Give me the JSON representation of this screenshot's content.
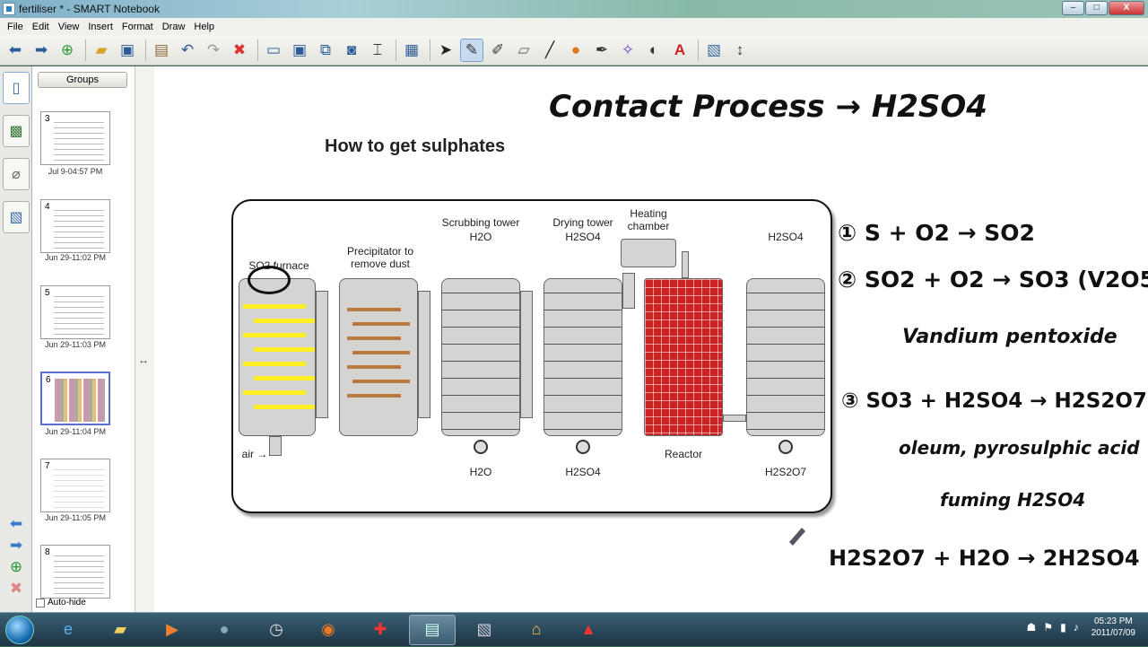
{
  "window": {
    "title": "fertiliser * - SMART Notebook",
    "min": "–",
    "max": "□",
    "close": "X"
  },
  "menu": [
    "File",
    "Edit",
    "View",
    "Insert",
    "Format",
    "Draw",
    "Help"
  ],
  "toolbar": {
    "icons": [
      "back-arrow-icon",
      "forward-arrow-icon",
      "add-page-icon",
      "open-folder-icon",
      "save-icon",
      "paste-icon",
      "undo-icon",
      "redo-icon",
      "delete-icon",
      "screen-shade-icon",
      "full-screen-icon",
      "dual-display-icon",
      "capture-icon",
      "table-icon",
      "insert-table-icon",
      "select-icon",
      "pen-icon",
      "creative-pen-icon",
      "eraser-icon",
      "line-icon",
      "shape-icon",
      "magic-pen-icon",
      "fill-icon",
      "text-icon",
      "properties-icon",
      "move-toolbar-icon"
    ]
  },
  "sorter": {
    "groups_label": "Groups",
    "autohide_label": "Auto-hide",
    "pages": [
      {
        "num": "3",
        "time": "Jul 9-04:57 PM"
      },
      {
        "num": "4",
        "time": "Jun 29-11:02 PM"
      },
      {
        "num": "5",
        "time": "Jun 29-11:03 PM"
      },
      {
        "num": "6",
        "time": "Jun 29-11:04 PM"
      },
      {
        "num": "7",
        "time": "Jun 29-11:05 PM"
      },
      {
        "num": "8",
        "time": ""
      }
    ]
  },
  "page": {
    "title": "How to get sulphates",
    "heading_ink": "Contact Process → H2SO4"
  },
  "diagram": {
    "labels": {
      "furnace": "SO2 furnace",
      "precipitator_1": "Precipitator to",
      "precipitator_2": "remove dust",
      "scrubbing": "Scrubbing tower",
      "scrubbing_in": "H2O",
      "drying": "Drying tower",
      "drying_in": "H2SO4",
      "heating_1": "Heating",
      "heating_2": "chamber",
      "absorber_in": "H2SO4",
      "air": "air →",
      "scrub_out": "H2O",
      "dry_out": "H2SO4",
      "reactor": "Reactor",
      "oleum_out": "H2S2O7"
    }
  },
  "notes": {
    "step1": "① S + O2 → SO2",
    "step2": "② SO2 + O2 → SO3 (V2O5)",
    "catalyst": "Vandium pentoxide",
    "step3": "③ SO3 + H2SO4 → H2S2O7",
    "oleum": "oleum, pyrosulphic acid",
    "fuming": "fuming H2SO4",
    "final": "H2S2O7 + H2O → 2H2SO4"
  },
  "taskbar": {
    "apps": [
      "ie-icon",
      "explorer-icon",
      "media-player-icon",
      "user-icon",
      "clock-app-icon",
      "firefox-icon",
      "pin-icon",
      "smart-notebook-icon",
      "recorder-icon",
      "home-icon",
      "pdf-icon"
    ],
    "time": "05:23 PM",
    "date": "2011/07/09"
  }
}
